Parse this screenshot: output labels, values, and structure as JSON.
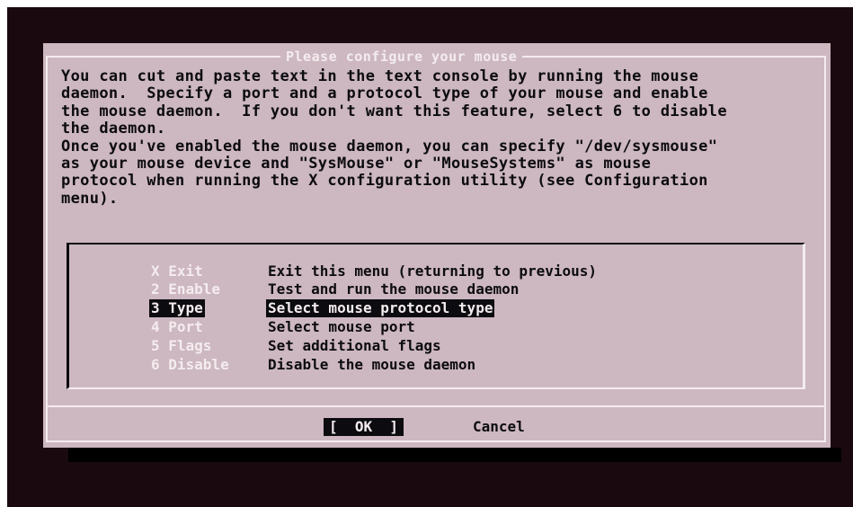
{
  "dialog": {
    "title": "Please configure your mouse",
    "description": "You can cut and paste text in the text console by running the mouse\ndaemon.  Specify a port and a protocol type of your mouse and enable\nthe mouse daemon.  If you don't want this feature, select 6 to disable\nthe daemon.\nOnce you've enabled the mouse daemon, you can specify \"/dev/sysmouse\"\nas your mouse device and \"SysMouse\" or \"MouseSystems\" as mouse\nprotocol when running the X configuration utility (see Configuration\nmenu)."
  },
  "menu": {
    "items": [
      {
        "tag": "X Exit",
        "description": "Exit this menu (returning to previous)"
      },
      {
        "tag": "2 Enable",
        "description": "Test and run the mouse daemon"
      },
      {
        "tag": "3 Type",
        "description": "Select mouse protocol type"
      },
      {
        "tag": "4 Port",
        "description": "Select mouse port"
      },
      {
        "tag": "5 Flags",
        "description": "Set additional flags"
      },
      {
        "tag": "6 Disable",
        "description": "Disable the mouse daemon"
      }
    ],
    "selected_index": 2
  },
  "buttons": {
    "ok": "[  OK  ]",
    "cancel": "Cancel"
  },
  "colors": {
    "screen_background": "#1a0a10",
    "dialog_background": "#cdb7c0",
    "text": "#0c0c10",
    "highlight_text": "#f4ecef",
    "selection_background": "#0c0c10"
  }
}
